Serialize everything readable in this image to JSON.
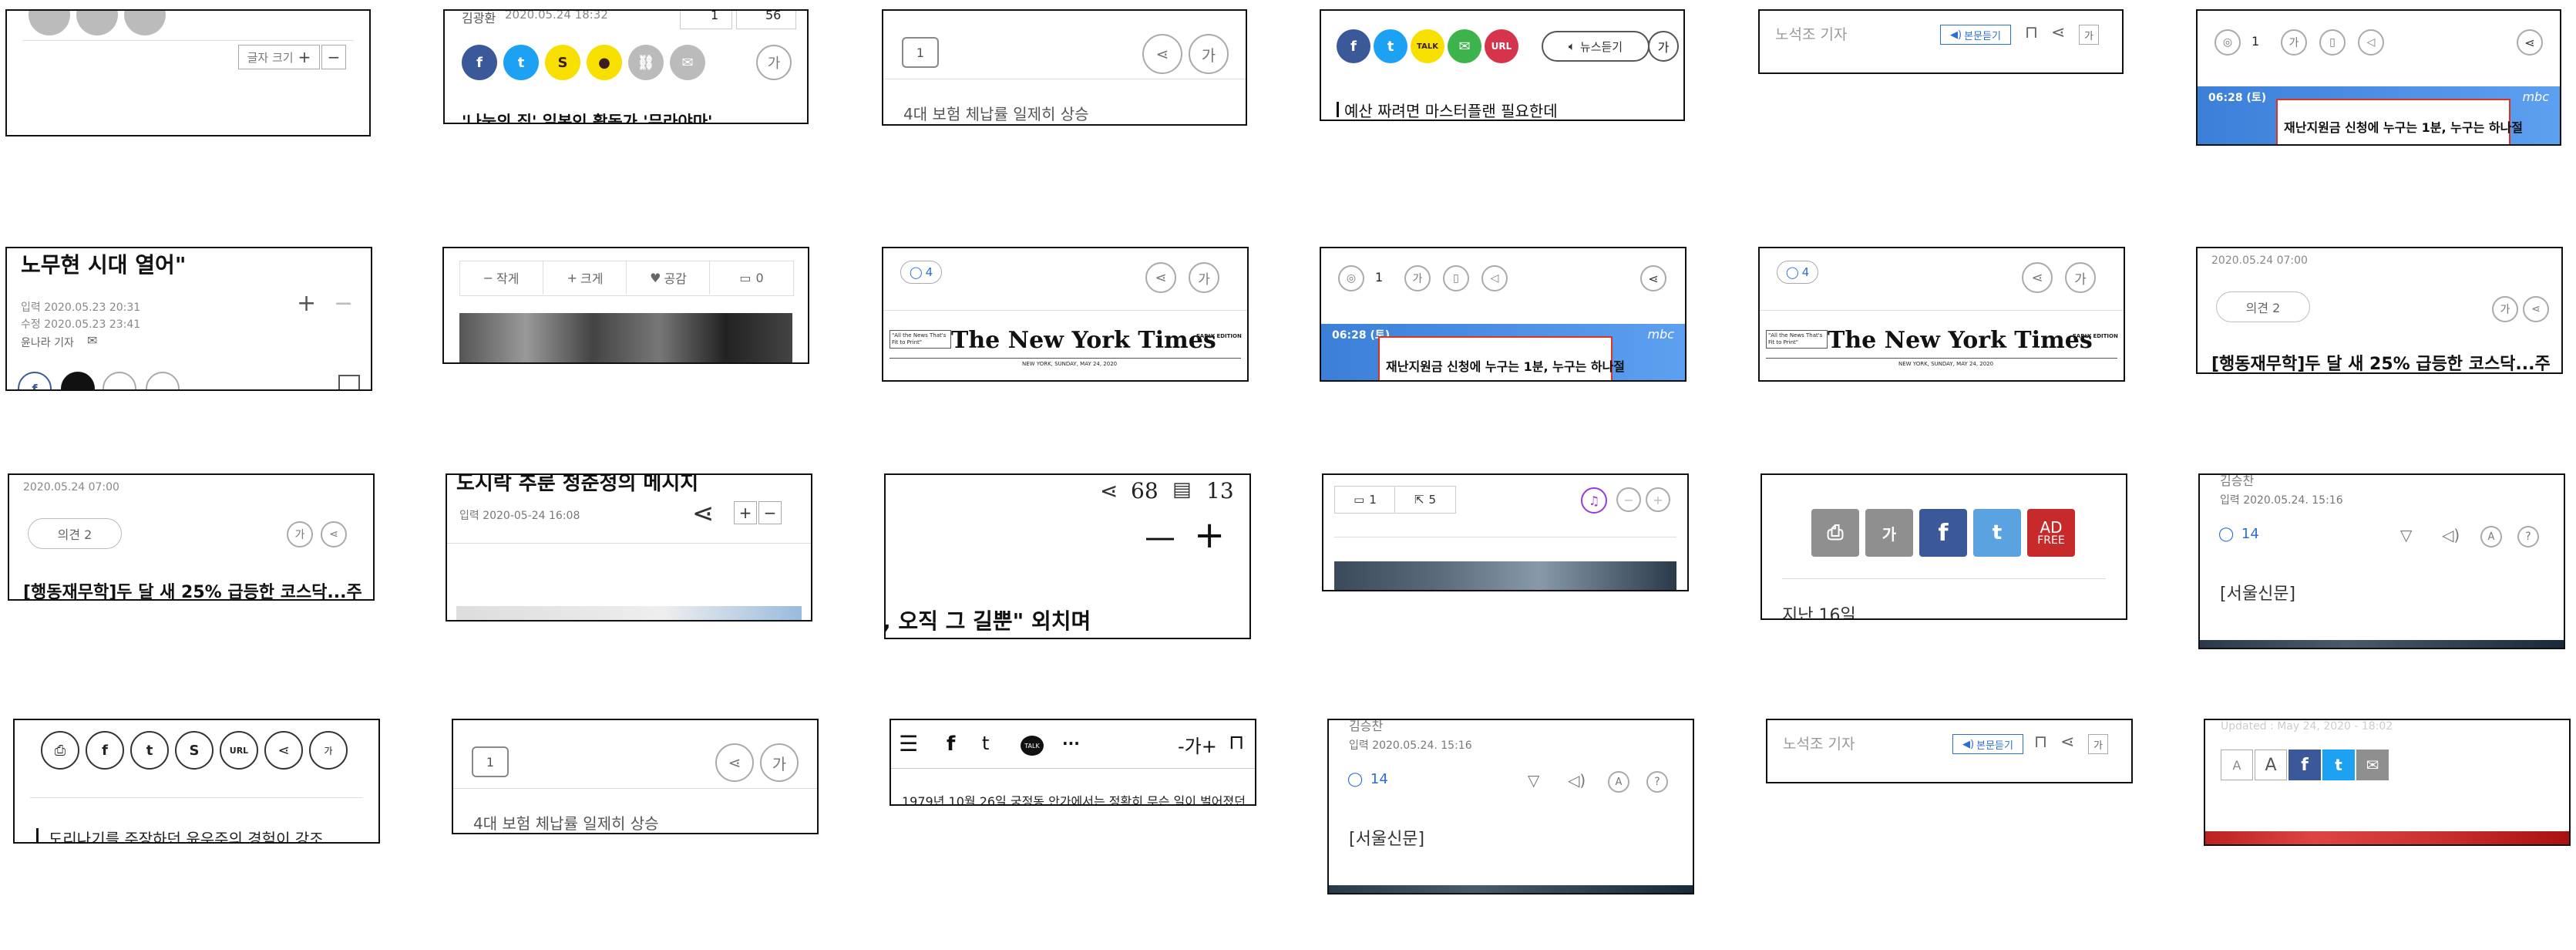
{
  "labels": {
    "font_size": "글자 크기",
    "plus": "+",
    "minus": "−",
    "ga": "가",
    "ga_small": "가",
    "ga_plusminus": "-가+",
    "url": "URL",
    "talk": "TALK",
    "more": "···",
    "mbc": "mbc",
    "nyt_name": "The New York Times",
    "nyt_edition": "EARLY EDITION",
    "nyt_tagline": "\"All the News That's Fit to Print\"",
    "nyt_dateline": "NEW YORK, SUNDAY, MAY 24, 2020",
    "news_listen": "뉴스듣기",
    "body_listen": "본문듣기",
    "reporter_noseokjo": "노석조 기자",
    "opinion_count": "의견 2",
    "small_write": "작게",
    "big_write": "크게",
    "like": "공감",
    "zero": "0",
    "ad_free_1": "AD",
    "ad_free_2": "FREE"
  },
  "cards": {
    "c1": {},
    "c2": {
      "partial_author": "김광환",
      "partial_date": "2020.05.24  18:32",
      "count_a": "1",
      "count_b": "56",
      "headline": "'나눔의 집' 일본인 활동가 '무라야마'..."
    },
    "c3": {
      "comment_count": "1",
      "headline": "4대 보험 체납률 일제히 상승"
    },
    "c4": {
      "headline": "예산 짜려면 마스터플랜 필요한데"
    },
    "c5": {},
    "c6": {
      "comment_count": "1",
      "broadcast_date": "06:28 (토)",
      "strip_text": "재난지원금 신청에 누구는 1분, 누구는 하나절"
    },
    "c7": {
      "headline": "노무현 시대 열어\"",
      "input_date": "입력 2020.05.23 20:31",
      "edit_date": "수정 2020.05.23 23:41",
      "reporter": "윤나라 기자"
    },
    "c8": {},
    "c9": {
      "comment_count": "4"
    },
    "c10": {
      "comment_count": "1",
      "broadcast_date": "06:28 (토)",
      "strip_text": "재난지원금 신청에 누구는 1분, 누구는 하나절"
    },
    "c11": {
      "comment_count": "4"
    },
    "c12": {
      "date": "2020.05.24  07:00",
      "headline": "[행동재무학]두 달 새 25% 급등한 코스닥...주"
    },
    "c13": {
      "date": "2020.05.24  07:00",
      "headline": "[행동재무학]두 달 새 25% 급등한 코스닥...주"
    },
    "c14": {
      "headline": "도시락 추룬 청춘정의 메시지",
      "input_date": "입력 2020-05-24 16:08"
    },
    "c15": {
      "share_count": "68",
      "comment_count": "13",
      "headline": ", 오직 그 길뿐\" 외치며"
    },
    "c16": {
      "comment_count": "1",
      "share_count": "5"
    },
    "c17": {
      "body": "지난 16일"
    },
    "c18": {
      "author": "김승찬",
      "input_date": "입력 2020.05.24.  15:16",
      "comment_count": "14",
      "body": "[서울신문]"
    },
    "c19": {
      "headline": "도리나기를 주장하던 윤우주의 경험이 강조"
    },
    "c20": {
      "comment_count": "1",
      "headline": "4대 보험 체납률 일제히 상승"
    },
    "c21": {
      "headline": "1979년 10월 26일 궁정동 안가에서는 정확히 무슨 일이 벌어졌던"
    },
    "c22": {
      "author": "김승찬",
      "input_date": "입력 2020.05.24.  15:16",
      "comment_count": "14",
      "body": "[서울신문]"
    },
    "c23": {},
    "c24": {
      "updated": "Updated : May 24, 2020 - 18:02"
    }
  },
  "icons": [
    "share-icon",
    "bookmark-icon",
    "print-icon",
    "speaker-icon",
    "headphones-icon",
    "comment-icon",
    "external-link-icon",
    "heart-icon",
    "email-icon",
    "link-icon",
    "facebook-icon",
    "twitter-icon",
    "kakaostory-icon",
    "kakaotalk-icon",
    "hamburger-icon",
    "filter-icon",
    "font-size-icon",
    "translate-icon",
    "refresh-icon"
  ],
  "colors": {
    "facebook": "#3b5998",
    "twitter": "#1da1f2",
    "kakao_yellow": "#f7e000",
    "line_green": "#3cb44b",
    "url_red": "#d6344c",
    "mbc_blue": "#3b7fd9",
    "ad_red": "#c62a2a",
    "gray_btn": "#8f8f8f"
  }
}
